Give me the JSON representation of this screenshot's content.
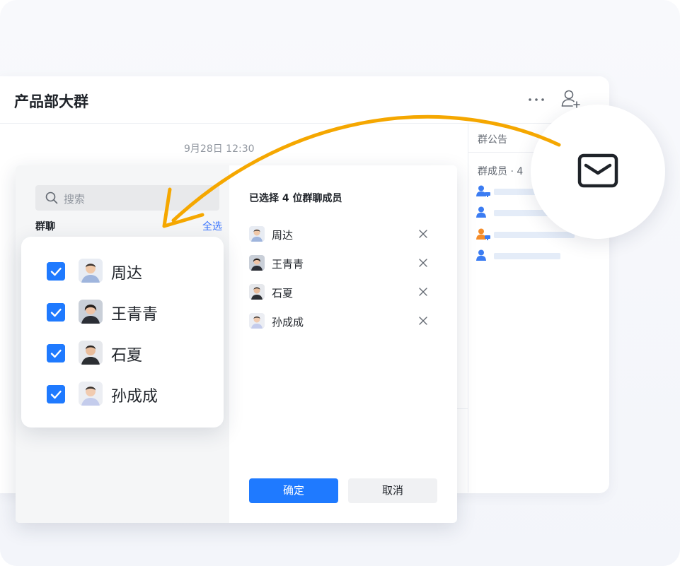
{
  "chat": {
    "title": "产品部大群",
    "timestamp": "9月28日 12:30"
  },
  "side_panel": {
    "notice_label": "群公告",
    "members_label": "群成员 · 4"
  },
  "dialog": {
    "search_placeholder": "搜索",
    "group_label": "群聊",
    "select_all": "全选",
    "selected_title": "已选择 4 位群聊成员",
    "selected_members": [
      {
        "name": "周达"
      },
      {
        "name": "王青青"
      },
      {
        "name": "石夏"
      },
      {
        "name": "孙成成"
      }
    ],
    "confirm_label": "确定",
    "cancel_label": "取消"
  },
  "checklist": [
    {
      "name": "周达",
      "checked": true
    },
    {
      "name": "王青青",
      "checked": true
    },
    {
      "name": "石夏",
      "checked": true
    },
    {
      "name": "孙成成",
      "checked": true
    }
  ],
  "icons": {
    "header_more": "more-horizontal-icon",
    "header_add_member": "add-user-icon",
    "mail": "mail-icon",
    "search": "search-icon",
    "remove": "close-icon",
    "checkbox": "checkbox-checked-icon"
  },
  "colors": {
    "accent": "#1f7aff",
    "link": "#3370ff",
    "arrow": "#f5a700",
    "member_icon_blue": "#3b7cf2",
    "member_icon_orange": "#f58c28"
  }
}
